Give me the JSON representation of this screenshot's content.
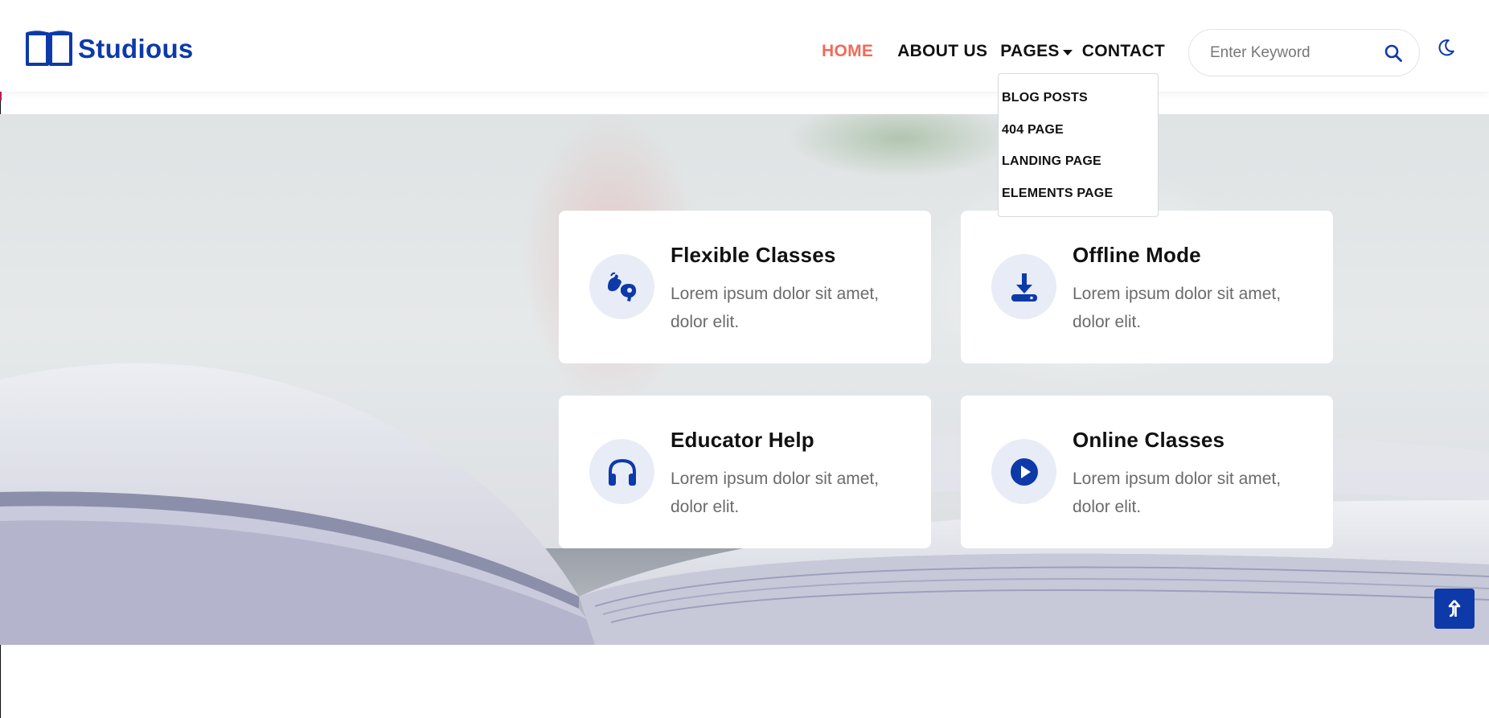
{
  "brand": {
    "name": "Studious",
    "icon": "open-book-icon",
    "color": "#0d3aa8"
  },
  "nav": {
    "home": "HOME",
    "about": "ABOUT US",
    "pages": "PAGES",
    "contact": "CONTACT",
    "active_color": "#f26a5a"
  },
  "dropdown": {
    "items": [
      "BLOG POSTS",
      "404 PAGE",
      "LANDING PAGE",
      "ELEMENTS PAGE"
    ]
  },
  "search": {
    "placeholder": "Enter Keyword",
    "icon": "search-icon"
  },
  "theme_toggle": {
    "icon": "moon-icon"
  },
  "features": [
    {
      "title": "Flexible Classes",
      "desc": "Lorem ipsum dolor sit amet, dolor elit.",
      "icon": "sign-language-icon"
    },
    {
      "title": "Offline Mode",
      "desc": "Lorem ipsum dolor sit amet, dolor elit.",
      "icon": "download-icon"
    },
    {
      "title": "Educator Help",
      "desc": "Lorem ipsum dolor sit amet, dolor elit.",
      "icon": "headphones-icon"
    },
    {
      "title": "Online Classes",
      "desc": "Lorem ipsum dolor sit amet, dolor elit.",
      "icon": "play-circle-icon"
    }
  ],
  "scroll_top": {
    "icon": "arrow-up-icon"
  },
  "colors": {
    "primary": "#0d3aa8",
    "icon_bg": "#e8ecf6",
    "text_muted": "#6b6b6b"
  }
}
